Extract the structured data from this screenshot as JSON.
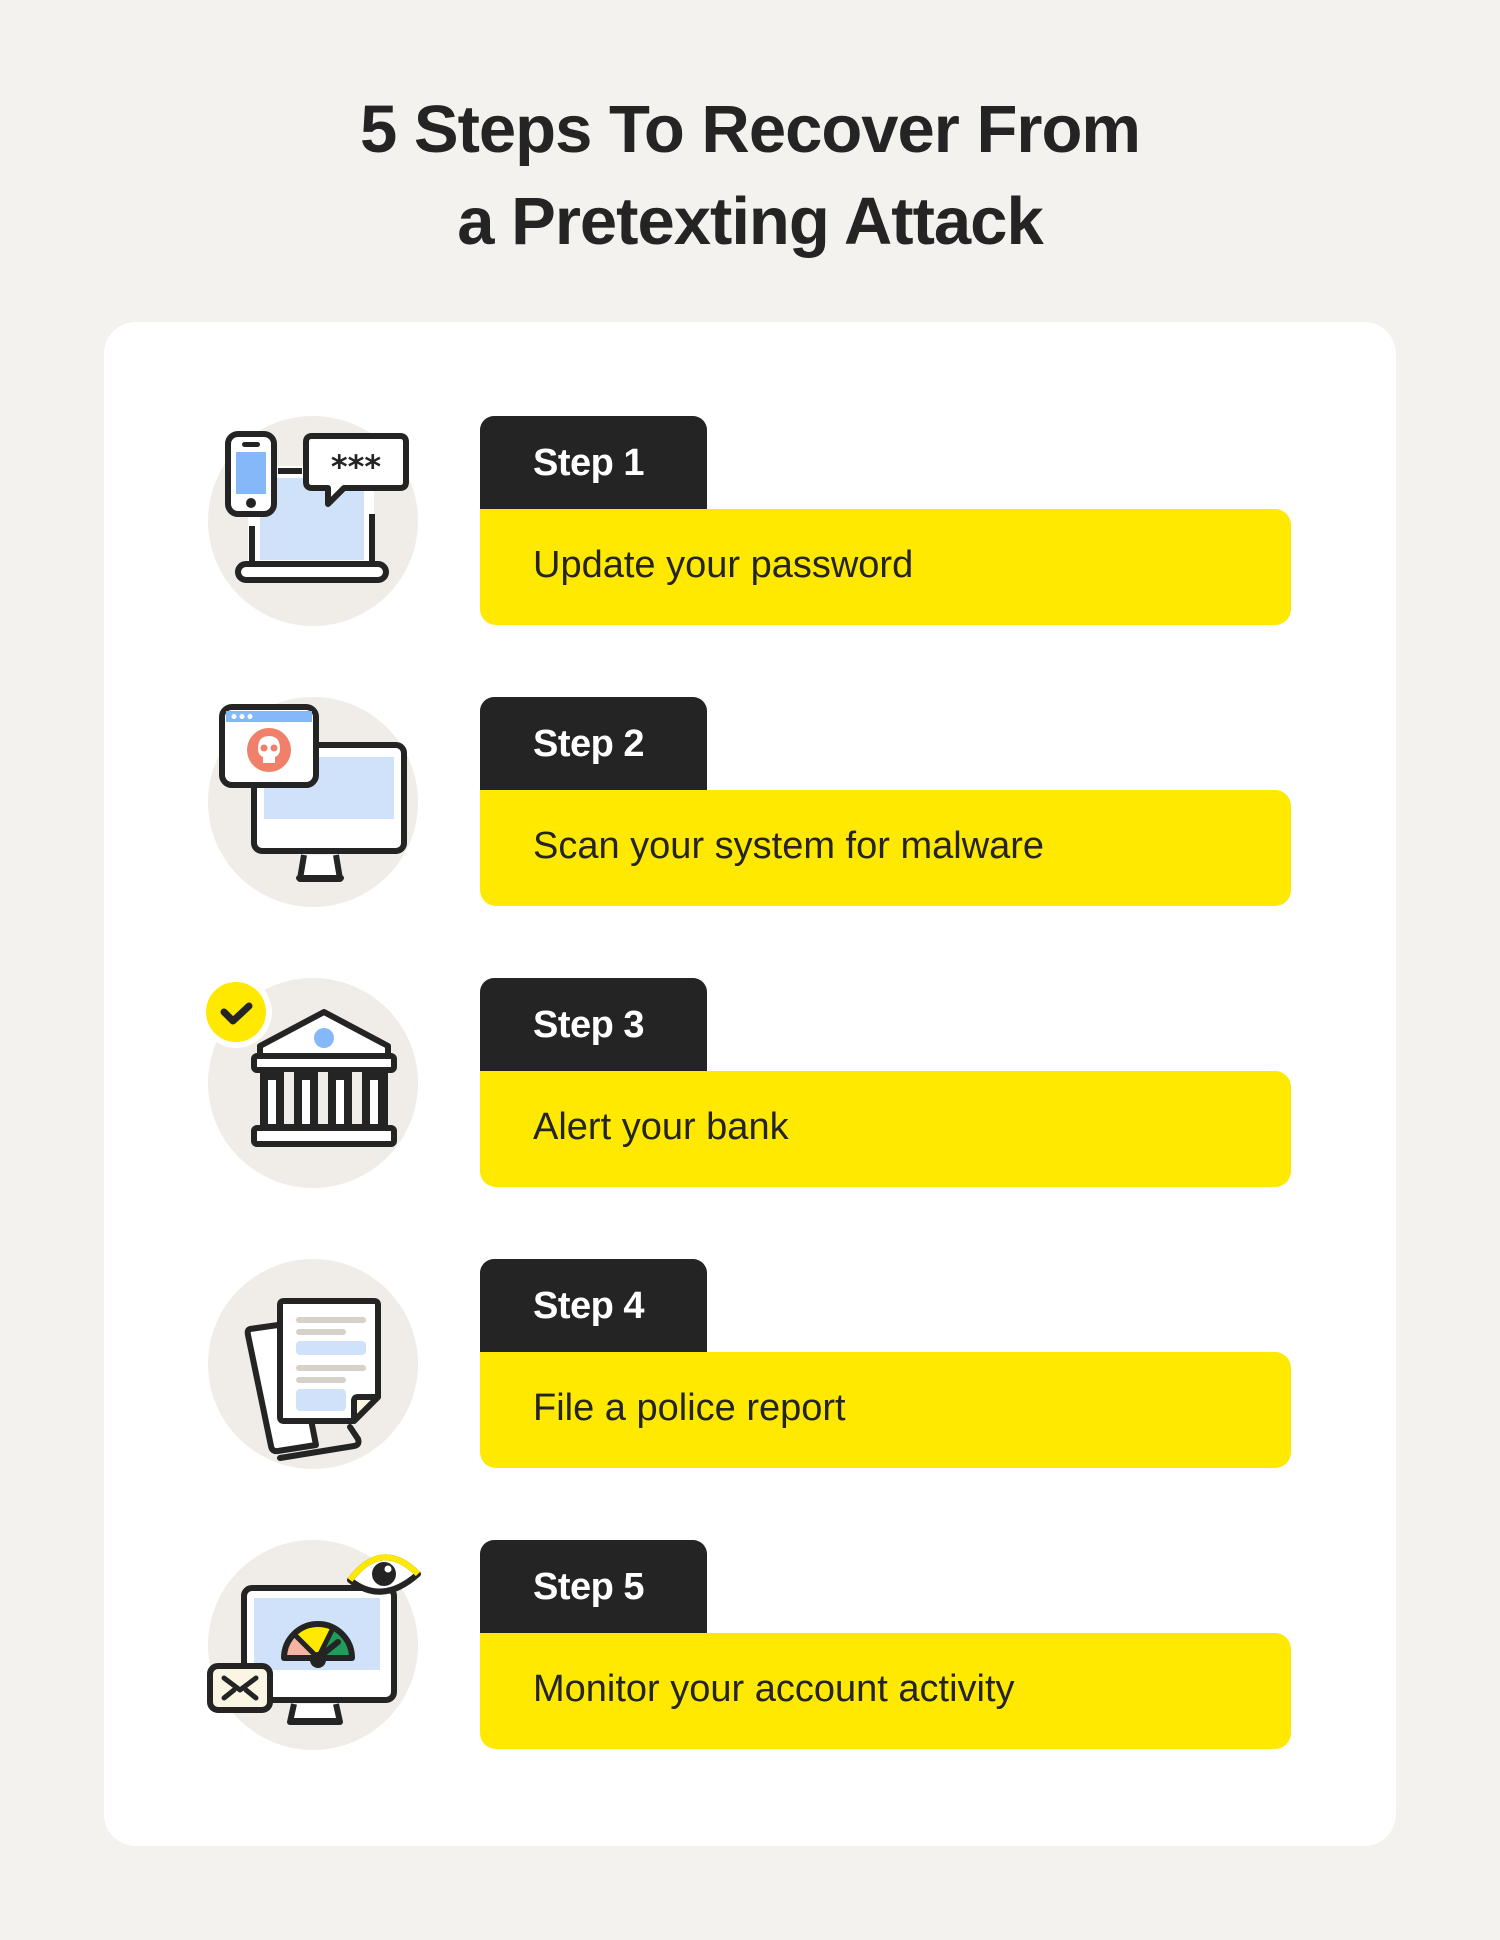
{
  "title": {
    "line1": "5 Steps To Recover From",
    "line2": "a Pretexting Attack"
  },
  "colors": {
    "background": "#F4F2EE",
    "card": "#FFFFFF",
    "dark": "#242424",
    "accent_yellow": "#FFE900",
    "light_blue": "#CFE2F9",
    "blue": "#84B8F8",
    "coral": "#F0806A",
    "icon_circle": "#F0EDE8"
  },
  "steps": [
    {
      "label": "Step 1",
      "text": "Update your password",
      "icon": "phone-laptop-password-icon"
    },
    {
      "label": "Step 2",
      "text": "Scan your system for malware",
      "icon": "monitor-malware-icon"
    },
    {
      "label": "Step 3",
      "text": "Alert your bank",
      "icon": "bank-check-icon"
    },
    {
      "label": "Step 4",
      "text": "File a police report",
      "icon": "documents-icon"
    },
    {
      "label": "Step 5",
      "text": "Monitor your account activity",
      "icon": "monitor-gauge-eye-icon"
    }
  ],
  "icon_text": {
    "password_mask": "***"
  }
}
